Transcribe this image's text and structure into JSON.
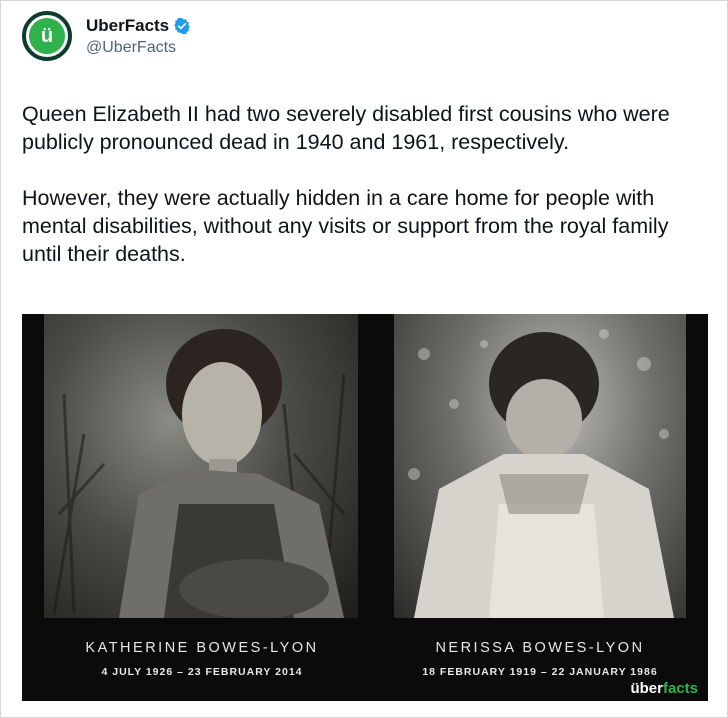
{
  "account": {
    "display_name": "UberFacts",
    "handle": "@UberFacts",
    "avatar_glyph": "ü",
    "verified": true
  },
  "tweet": {
    "paragraph_1": "Queen Elizabeth II had two severely disabled first cousins who were publicly pronounced dead in 1940 and 1961, respectively.",
    "paragraph_2": "However, they were actually hidden in a care home for people with mental disabilities, without any visits or support from the royal family until their deaths."
  },
  "media": {
    "left_caption": {
      "name": "KATHERINE BOWES-LYON",
      "dates": "4 JULY 1926 – 23 FEBRUARY 2014"
    },
    "right_caption": {
      "name": "NERISSA BOWES-LYON",
      "dates": "18 FEBRUARY 1919 – 22 JANUARY 1986"
    },
    "watermark_prefix": "über",
    "watermark_suffix": "facts"
  },
  "colors": {
    "brand_green": "#2fb24c",
    "verified_blue": "#1d9bf0",
    "text": "#0f1419",
    "secondary_text": "#536471"
  },
  "icons": {
    "verified": "verified-badge-icon",
    "avatar": "uberfacts-logo-icon"
  }
}
